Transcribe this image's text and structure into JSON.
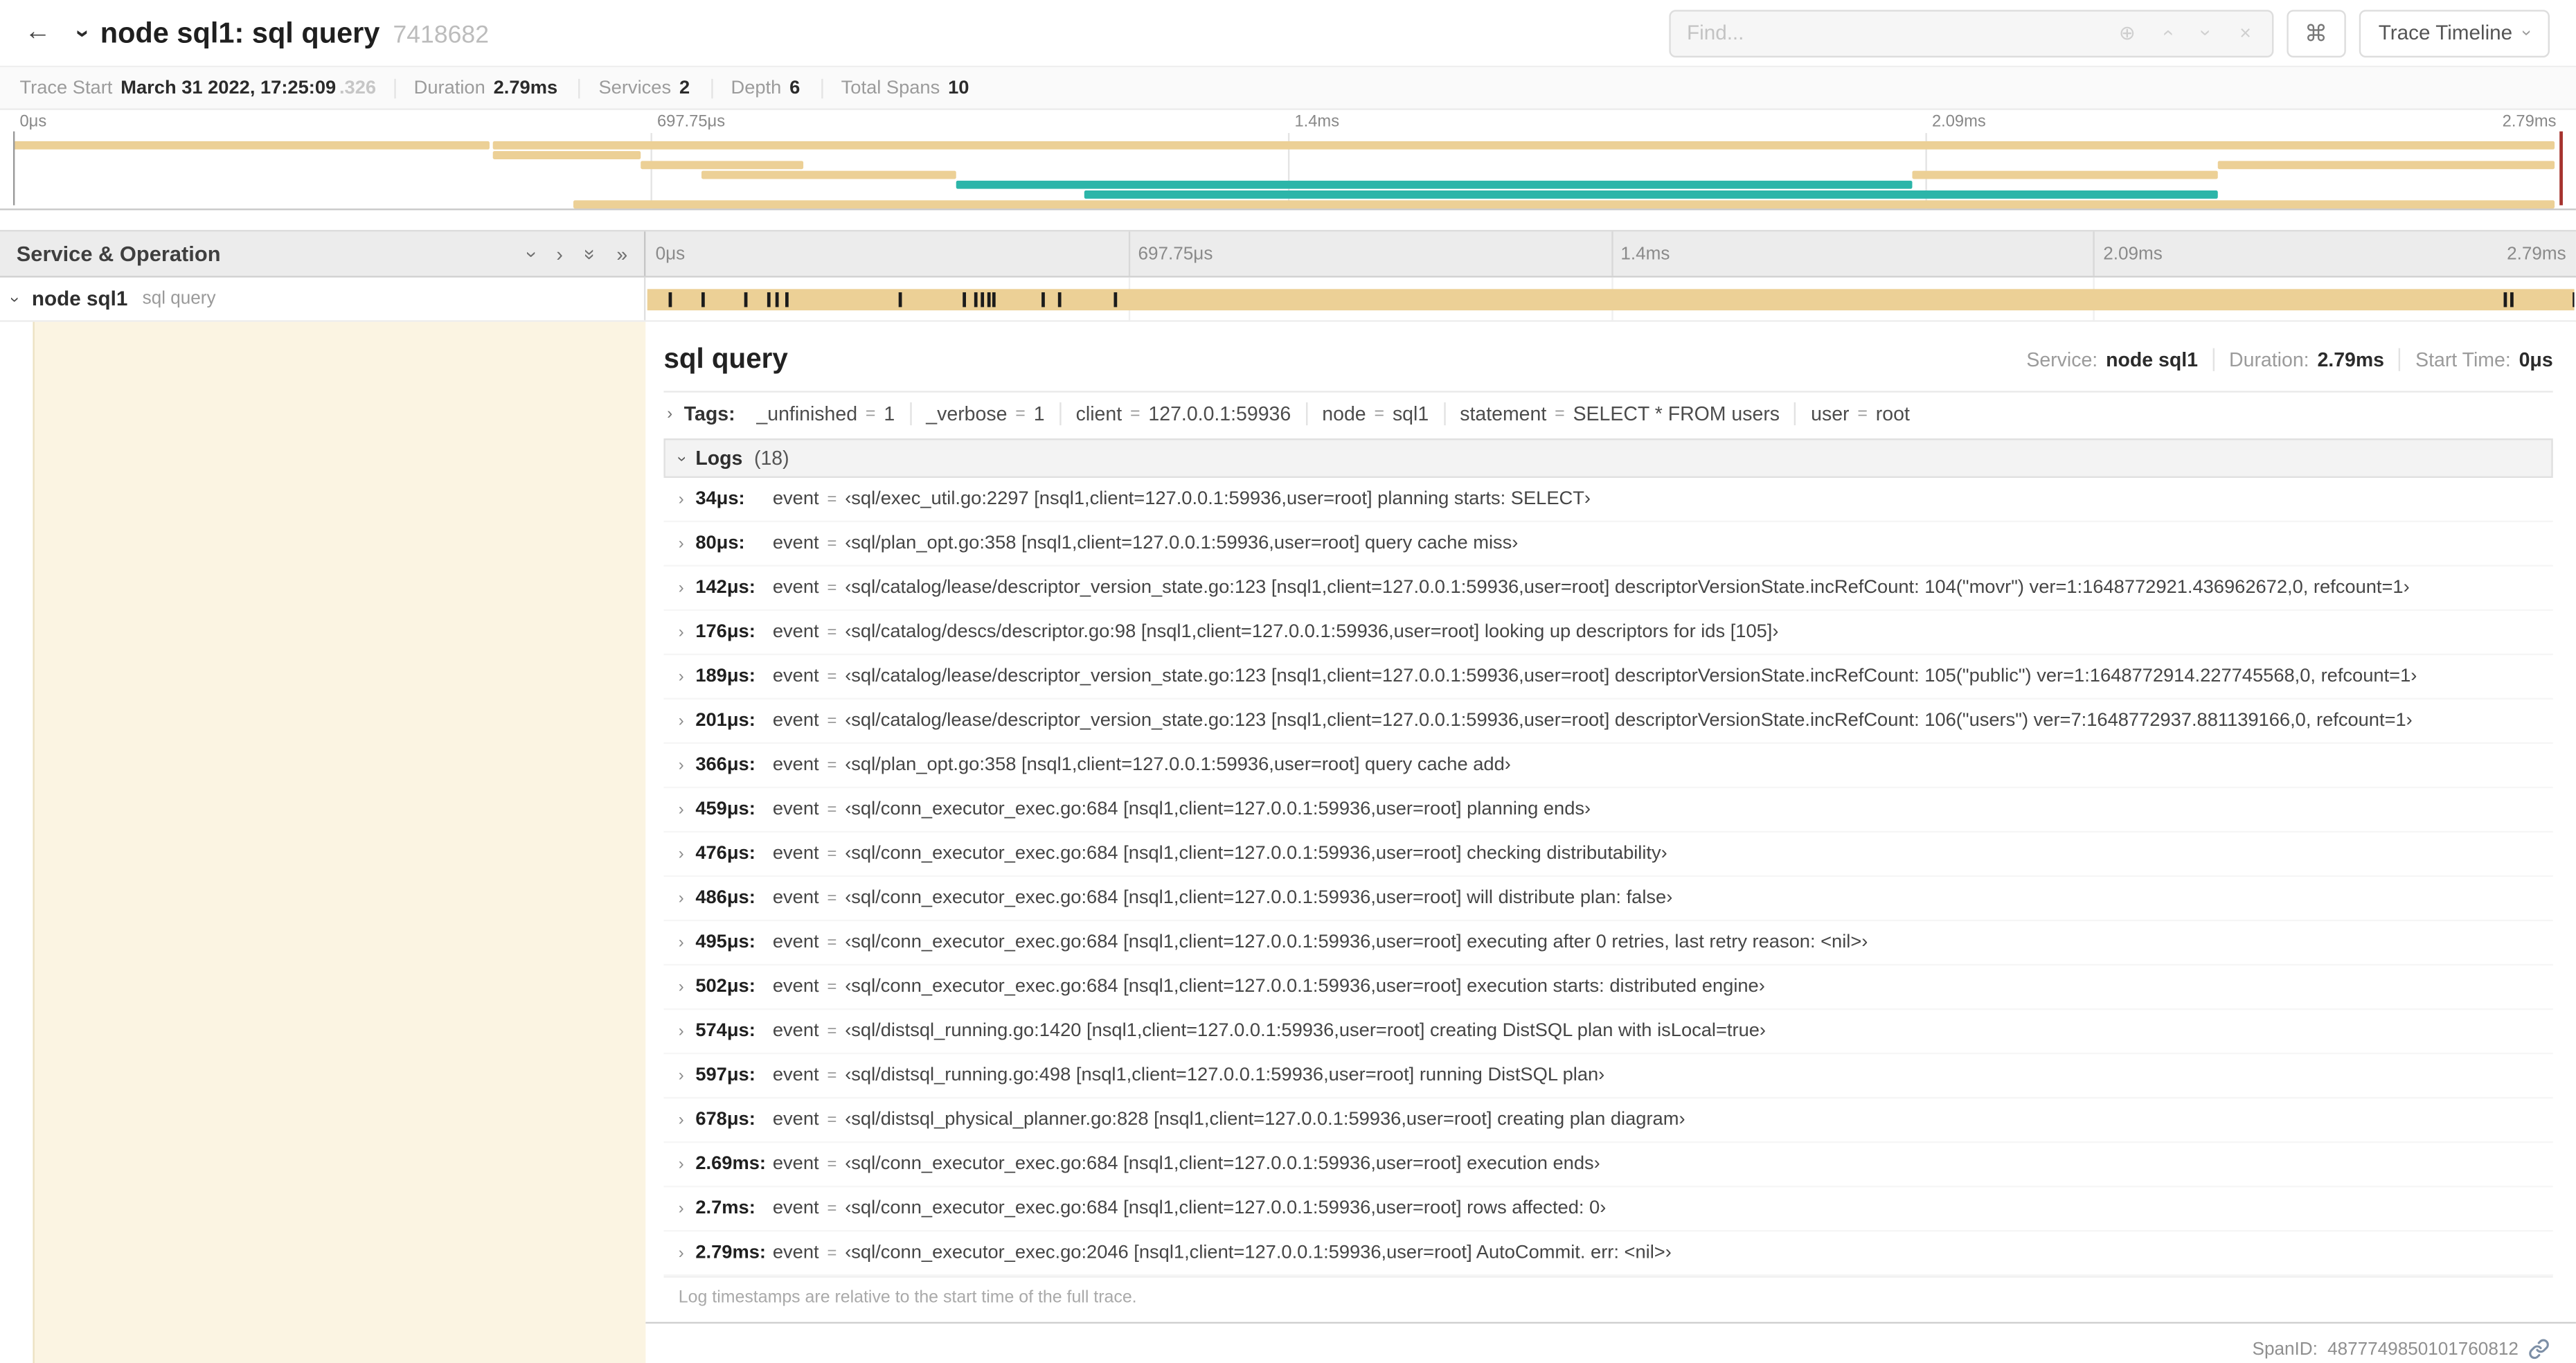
{
  "colors": {
    "span_tan": "#ecd096",
    "span_teal": "#2cb5a9",
    "selected_row_bg": "#fbf4e2",
    "scrubber_red": "#a5332e"
  },
  "icons": {
    "back": "←",
    "chevron": "›",
    "double_chevron": "»",
    "command": "⌘",
    "circle_plus": "⊕",
    "close": "×"
  },
  "header": {
    "title": "node sql1: sql query",
    "trace_id": "7418682",
    "find_placeholder": "Find...",
    "view_button": "Trace Timeline"
  },
  "summary": {
    "items": [
      {
        "label": "Trace Start",
        "value": "March 31 2022, 17:25:09",
        "dim": ".326"
      },
      {
        "label": "Duration",
        "value": "2.79ms",
        "dim": ""
      },
      {
        "label": "Services",
        "value": "2",
        "dim": ""
      },
      {
        "label": "Depth",
        "value": "6",
        "dim": ""
      },
      {
        "label": "Total Spans",
        "value": "10",
        "dim": ""
      }
    ]
  },
  "timeline": {
    "duration_us": 2790,
    "ticks": [
      "0μs",
      "697.75μs",
      "1.4ms",
      "2.09ms",
      "2.79ms"
    ],
    "minimap_spans": [
      {
        "row": 0,
        "start": 0,
        "end": 18.7,
        "color": "tan"
      },
      {
        "row": 0,
        "start": 18.8,
        "end": 99.7,
        "color": "tan"
      },
      {
        "row": 1,
        "start": 18.8,
        "end": 24.6,
        "color": "tan"
      },
      {
        "row": 2,
        "start": 24.6,
        "end": 31,
        "color": "tan"
      },
      {
        "row": 2,
        "start": 86.5,
        "end": 99.7,
        "color": "tan"
      },
      {
        "row": 3,
        "start": 27,
        "end": 37,
        "color": "tan"
      },
      {
        "row": 3,
        "start": 74.5,
        "end": 86.5,
        "color": "tan"
      },
      {
        "row": 4,
        "start": 37,
        "end": 74.5,
        "color": "teal"
      },
      {
        "row": 5,
        "start": 42,
        "end": 86.5,
        "color": "teal"
      },
      {
        "row": 6,
        "start": 22,
        "end": 99.7,
        "color": "tan"
      }
    ]
  },
  "grid": {
    "header_label": "Service & Operation"
  },
  "span_row": {
    "service": "node sql1",
    "operation": "sql query"
  },
  "detail": {
    "title": "sql query",
    "meta": [
      {
        "label": "Service:",
        "value": "node sql1"
      },
      {
        "label": "Duration:",
        "value": "2.79ms"
      },
      {
        "label": "Start Time:",
        "value": "0μs"
      }
    ],
    "tags_label": "Tags:",
    "eq": "=",
    "tags": [
      {
        "key": "_unfinished",
        "value": "1"
      },
      {
        "key": "_verbose",
        "value": "1"
      },
      {
        "key": "client",
        "value": "127.0.0.1:59936"
      },
      {
        "key": "node",
        "value": "sql1"
      },
      {
        "key": "statement",
        "value": "SELECT * FROM users"
      },
      {
        "key": "user",
        "value": "root"
      }
    ],
    "logs_label": "Logs",
    "logs_count": "(18)",
    "logs": [
      {
        "label": "34μs:",
        "us": 34,
        "field": "event",
        "value": "‹sql/exec_util.go:2297 [nsql1,client=127.0.0.1:59936,user=root] planning starts: SELECT›"
      },
      {
        "label": "80μs:",
        "us": 80,
        "field": "event",
        "value": "‹sql/plan_opt.go:358 [nsql1,client=127.0.0.1:59936,user=root] query cache miss›"
      },
      {
        "label": "142μs:",
        "us": 142,
        "field": "event",
        "value": "‹sql/catalog/lease/descriptor_version_state.go:123 [nsql1,client=127.0.0.1:59936,user=root] descriptorVersionState.incRefCount: 104(\"movr\") ver=1:1648772921.436962672,0, refcount=1›"
      },
      {
        "label": "176μs:",
        "us": 176,
        "field": "event",
        "value": "‹sql/catalog/descs/descriptor.go:98 [nsql1,client=127.0.0.1:59936,user=root] looking up descriptors for ids [105]›"
      },
      {
        "label": "189μs:",
        "us": 189,
        "field": "event",
        "value": "‹sql/catalog/lease/descriptor_version_state.go:123 [nsql1,client=127.0.0.1:59936,user=root] descriptorVersionState.incRefCount: 105(\"public\") ver=1:1648772914.227745568,0, refcount=1›"
      },
      {
        "label": "201μs:",
        "us": 201,
        "field": "event",
        "value": "‹sql/catalog/lease/descriptor_version_state.go:123 [nsql1,client=127.0.0.1:59936,user=root] descriptorVersionState.incRefCount: 106(\"users\") ver=7:1648772937.881139166,0, refcount=1›"
      },
      {
        "label": "366μs:",
        "us": 366,
        "field": "event",
        "value": "‹sql/plan_opt.go:358 [nsql1,client=127.0.0.1:59936,user=root] query cache add›"
      },
      {
        "label": "459μs:",
        "us": 459,
        "field": "event",
        "value": "‹sql/conn_executor_exec.go:684 [nsql1,client=127.0.0.1:59936,user=root] planning ends›"
      },
      {
        "label": "476μs:",
        "us": 476,
        "field": "event",
        "value": "‹sql/conn_executor_exec.go:684 [nsql1,client=127.0.0.1:59936,user=root] checking distributability›"
      },
      {
        "label": "486μs:",
        "us": 486,
        "field": "event",
        "value": "‹sql/conn_executor_exec.go:684 [nsql1,client=127.0.0.1:59936,user=root] will distribute plan: false›"
      },
      {
        "label": "495μs:",
        "us": 495,
        "field": "event",
        "value": "‹sql/conn_executor_exec.go:684 [nsql1,client=127.0.0.1:59936,user=root] executing after 0 retries, last retry reason: <nil>›"
      },
      {
        "label": "502μs:",
        "us": 502,
        "field": "event",
        "value": "‹sql/conn_executor_exec.go:684 [nsql1,client=127.0.0.1:59936,user=root] execution starts: distributed engine›"
      },
      {
        "label": "574μs:",
        "us": 574,
        "field": "event",
        "value": "‹sql/distsql_running.go:1420 [nsql1,client=127.0.0.1:59936,user=root] creating DistSQL plan with isLocal=true›"
      },
      {
        "label": "597μs:",
        "us": 597,
        "field": "event",
        "value": "‹sql/distsql_running.go:498 [nsql1,client=127.0.0.1:59936,user=root] running DistSQL plan›"
      },
      {
        "label": "678μs:",
        "us": 678,
        "field": "event",
        "value": "‹sql/distsql_physical_planner.go:828 [nsql1,client=127.0.0.1:59936,user=root] creating plan diagram›"
      },
      {
        "label": "2.69ms:",
        "us": 2690,
        "field": "event",
        "value": "‹sql/conn_executor_exec.go:684 [nsql1,client=127.0.0.1:59936,user=root] execution ends›"
      },
      {
        "label": "2.7ms:",
        "us": 2700,
        "field": "event",
        "value": "‹sql/conn_executor_exec.go:684 [nsql1,client=127.0.0.1:59936,user=root] rows affected: 0›"
      },
      {
        "label": "2.79ms:",
        "us": 2790,
        "field": "event",
        "value": "‹sql/conn_executor_exec.go:2046 [nsql1,client=127.0.0.1:59936,user=root] AutoCommit. err: <nil>›"
      }
    ],
    "footnote": "Log timestamps are relative to the start time of the full trace.",
    "spanid_label": "SpanID:",
    "spanid": "4877749850101760812"
  }
}
